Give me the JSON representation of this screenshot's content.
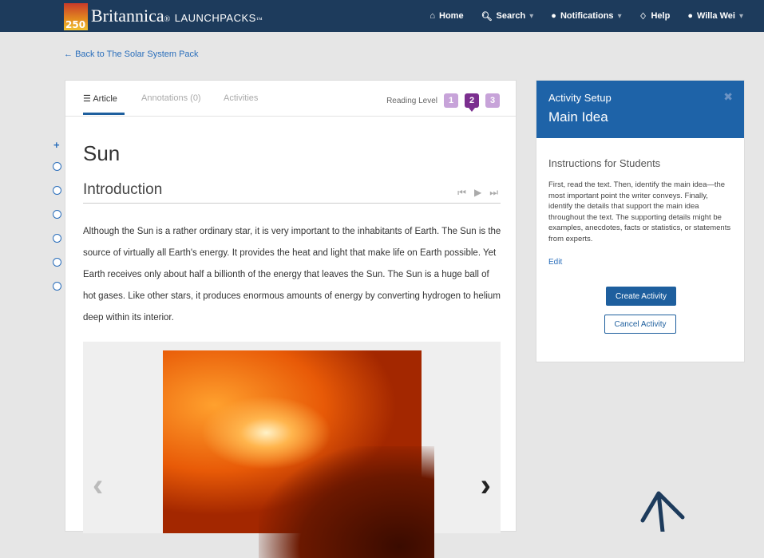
{
  "header": {
    "brand_badge": "250",
    "brand_name": "Britannica",
    "brand_sub": "LAUNCHPACKS",
    "nav": [
      {
        "label": "Home",
        "icon": "home-icon"
      },
      {
        "label": "Search",
        "icon": "search-icon"
      },
      {
        "label": "Notifications",
        "icon": "chat-bubble-icon"
      },
      {
        "label": "Help",
        "icon": "lightbulb-icon"
      },
      {
        "label": "Willa Wei",
        "icon": "user-icon"
      }
    ]
  },
  "back_link": "Back to The Solar System Pack",
  "article": {
    "tabs": {
      "article": "Article",
      "annotations": "Annotations (0)",
      "activities": "Activities"
    },
    "reading_level_label": "Reading Level",
    "reading_levels": [
      "1",
      "2",
      "3"
    ],
    "active_reading_level": "2",
    "title": "Sun",
    "section": "Introduction",
    "body": "Although the Sun is a rather ordinary star, it is very important to the inhabitants of Earth. The Sun is the source of virtually all Earth's energy. It provides the heat and light that make life on Earth possible. Yet Earth receives only about half a billionth of the energy that leaves the Sun. The Sun is a huge ball of hot gases. Like other stars, it produces enormous amounts of energy by converting hydrogen to helium deep within its interior."
  },
  "panel": {
    "small_title": "Activity Setup",
    "big_title": "Main Idea",
    "instructions_title": "Instructions for Students",
    "instructions_text": "First, read the text. Then, identify the main idea—the most important point the writer conveys. Finally, identify the details that support the main idea throughout the text. The supporting details might be examples, anecdotes, facts or statistics, or statements from experts.",
    "edit_label": "Edit",
    "create_label": "Create Activity",
    "cancel_label": "Cancel Activity"
  },
  "colors": {
    "header_bg": "#1d3b5c",
    "panel_header": "#1e63a8",
    "accent_purple": "#7b2f8f",
    "link_blue": "#2a6ebb"
  }
}
